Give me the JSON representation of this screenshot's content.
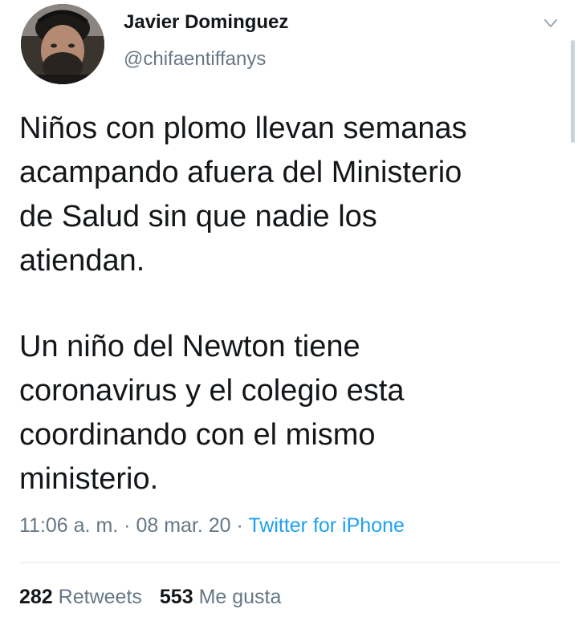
{
  "author": {
    "display_name": "Javier Dominguez",
    "handle": "@chifaentiffanys"
  },
  "tweet": {
    "paragraphs": [
      "Niños con plomo llevan semanas\nacampando afuera del Ministerio\nde Salud sin que nadie los\natiendan.",
      "Un niño del Newton tiene\ncoronavirus y el colegio esta\ncoordinando con el mismo\nministerio."
    ],
    "time": "11:06 a. m.",
    "date": "08 mar. 20",
    "separator": "·",
    "source": "Twitter for iPhone"
  },
  "stats": {
    "retweets_count": "282",
    "retweets_label": "Retweets",
    "likes_count": "553",
    "likes_label": "Me gusta"
  },
  "colors": {
    "text": "#14171a",
    "secondary": "#657786",
    "link": "#1da1f2",
    "divider": "#e1e8ed"
  },
  "icons": {
    "caret": "chevron-down-icon",
    "avatar": "profile-photo"
  }
}
